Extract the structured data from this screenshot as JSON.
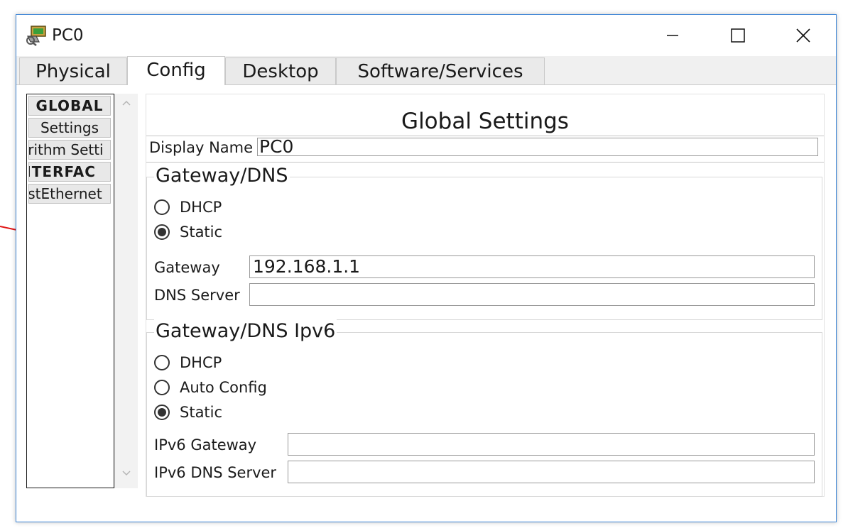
{
  "window": {
    "title": "PC0"
  },
  "tabs": [
    {
      "label": "Physical"
    },
    {
      "label": "Config"
    },
    {
      "label": "Desktop"
    },
    {
      "label": "Software/Services"
    }
  ],
  "sidebar": {
    "items": [
      {
        "label": "GLOBAL"
      },
      {
        "label": "Settings"
      },
      {
        "label": "orithm Setti"
      },
      {
        "label": "NTERFAC"
      },
      {
        "label": "astEthernet"
      }
    ]
  },
  "global_settings": {
    "title": "Global Settings",
    "display_name_label": "Display Name",
    "display_name_value": "PC0",
    "gateway_dns": {
      "title": "Gateway/DNS",
      "dhcp_label": "DHCP",
      "static_label": "Static",
      "selected": "Static",
      "gateway_label": "Gateway",
      "gateway_value": "192.168.1.1",
      "dns_label": "DNS Server",
      "dns_value": ""
    },
    "gateway_dns_ipv6": {
      "title": "Gateway/DNS Ipv6",
      "dhcp_label": "DHCP",
      "auto_label": "Auto Config",
      "static_label": "Static",
      "selected": "Static",
      "gateway_label": "IPv6 Gateway",
      "gateway_value": "",
      "dns_label": "IPv6 DNS Server",
      "dns_value": ""
    }
  }
}
